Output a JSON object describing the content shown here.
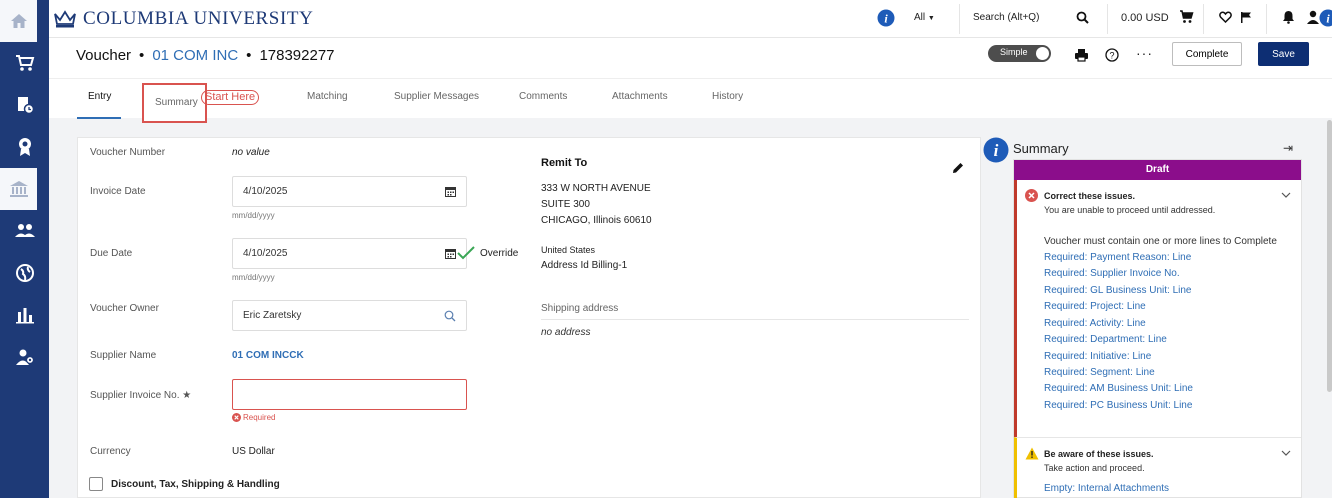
{
  "topbar": {
    "logo_text": "COLUMBIA UNIVERSITY",
    "search_scope": "All",
    "search_placeholder": "Search (Alt+Q)",
    "cart_total": "0.00 USD"
  },
  "header": {
    "title": "Voucher",
    "supplier": "01 COM INC",
    "voucher_id": "178392277",
    "view_mode": "Simple",
    "complete_label": "Complete",
    "save_label": "Save"
  },
  "tabs": [
    {
      "label": "Entry",
      "active": true
    },
    {
      "label": "Summary"
    },
    {
      "label": "Matching"
    },
    {
      "label": "Supplier Messages"
    },
    {
      "label": "Comments"
    },
    {
      "label": "Attachments"
    },
    {
      "label": "History"
    }
  ],
  "annotation": {
    "start_here": "Start Here"
  },
  "form": {
    "voucher_number": {
      "label": "Voucher Number",
      "value": "no value"
    },
    "invoice_date": {
      "label": "Invoice Date",
      "value": "4/10/2025",
      "hint": "mm/dd/yyyy"
    },
    "due_date": {
      "label": "Due Date",
      "value": "4/10/2025",
      "hint": "mm/dd/yyyy",
      "override": "Override"
    },
    "voucher_owner": {
      "label": "Voucher Owner",
      "value": "Eric Zaretsky"
    },
    "supplier_name": {
      "label": "Supplier Name",
      "value": "01 COM INCCK"
    },
    "supplier_invoice": {
      "label": "Supplier Invoice No.",
      "value": "",
      "error": "Required"
    },
    "currency": {
      "label": "Currency",
      "value": "US Dollar"
    },
    "discount_checkbox": "Discount, Tax, Shipping & Handling"
  },
  "remit": {
    "title": "Remit To",
    "address_lines": [
      "333 W NORTH AVENUE",
      "SUITE 300",
      "CHICAGO, Illinois 60610"
    ],
    "country": "United States",
    "address_id": "Address Id Billing-1",
    "shipping_label": "Shipping address",
    "shipping_value": "no address"
  },
  "summary": {
    "title": "Summary",
    "status": "Draft",
    "errors": {
      "title": "Correct these issues.",
      "subtitle": "You are unable to proceed until addressed.",
      "message": "Voucher must contain one or more lines to Complete",
      "links": [
        "Required: Payment Reason: Line",
        "Required: Supplier Invoice No.",
        "Required: GL Business Unit: Line",
        "Required: Project: Line",
        "Required: Activity: Line",
        "Required: Department: Line",
        "Required: Initiative: Line",
        "Required: Segment: Line",
        "Required: AM Business Unit: Line",
        "Required: PC Business Unit: Line"
      ]
    },
    "warnings": {
      "title": "Be aware of these issues.",
      "subtitle": "Take action and proceed.",
      "link": "Empty: Internal Attachments"
    }
  },
  "colors": {
    "brand_navy": "#1e3a77",
    "link_blue": "#2f6eb5",
    "draft_purple": "#8b0d8b",
    "error_red": "#c0392b",
    "warning_yellow": "#f0c000",
    "save_button": "#0d2e73"
  }
}
